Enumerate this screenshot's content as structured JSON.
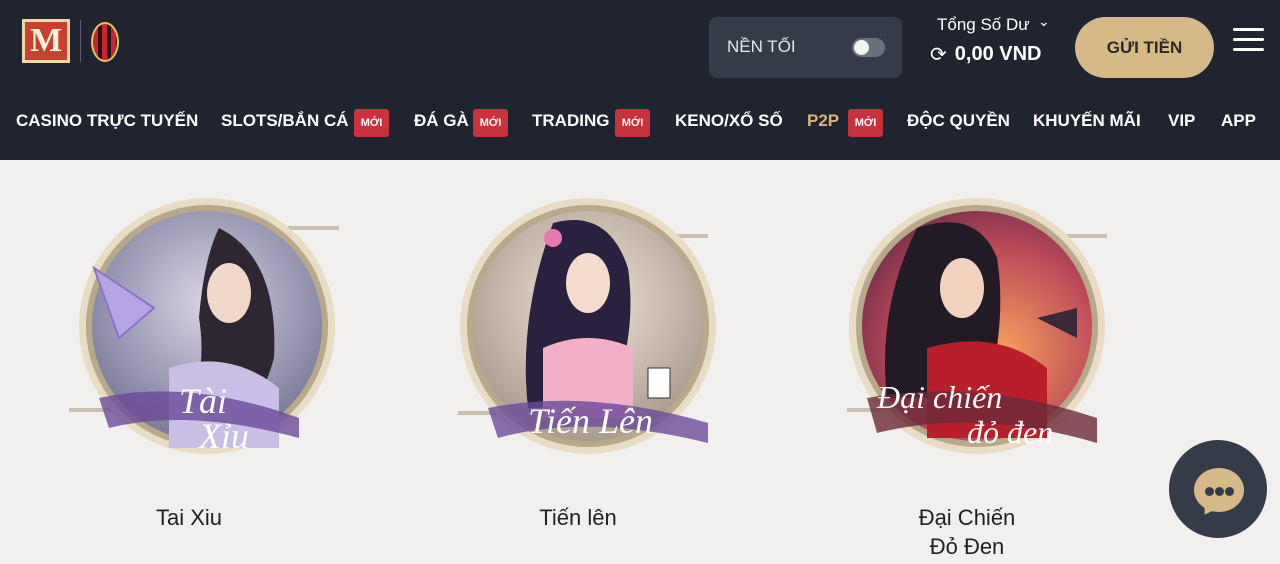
{
  "header": {
    "logo_text": "M",
    "theme_toggle_label": "NỀN TỐI",
    "balance_label": "Tổng Số Dư",
    "balance_value": "0,00 VND",
    "deposit_label": "GỬI TIỀN"
  },
  "nav": {
    "badge": "MỚI",
    "items": [
      {
        "label": "CASINO TRỰC TUYẾN"
      },
      {
        "label": "SLOTS/BẮN CÁ"
      },
      {
        "label": "ĐÁ GÀ"
      },
      {
        "label": "TRADING"
      },
      {
        "label": "KENO/XỔ SỐ"
      },
      {
        "label": "P2P"
      },
      {
        "label": "ĐỘC QUYỀN"
      },
      {
        "label": "KHUYẾN MÃI"
      },
      {
        "label": "VIP"
      },
      {
        "label": "APP"
      }
    ]
  },
  "games": [
    {
      "title": "Tai Xiu",
      "art_text_1": "Tài",
      "art_text_2": "Xỉu"
    },
    {
      "title": "Tiến lên",
      "art_text_1": "Tiến Lên",
      "art_text_2": ""
    },
    {
      "title_line1": "Đại Chiến",
      "title_line2": "Đỏ Đen",
      "art_text_1": "Đại chiến",
      "art_text_2": "đỏ đen"
    }
  ],
  "colors": {
    "header_bg": "#1f2430",
    "accent_gold": "#d6b987",
    "badge_red": "#c8323c",
    "page_bg": "#f2f0ee"
  },
  "icons": [
    "club-crest-icon",
    "refresh-icon",
    "chevron-down-icon",
    "menu-icon",
    "chat-icon"
  ]
}
